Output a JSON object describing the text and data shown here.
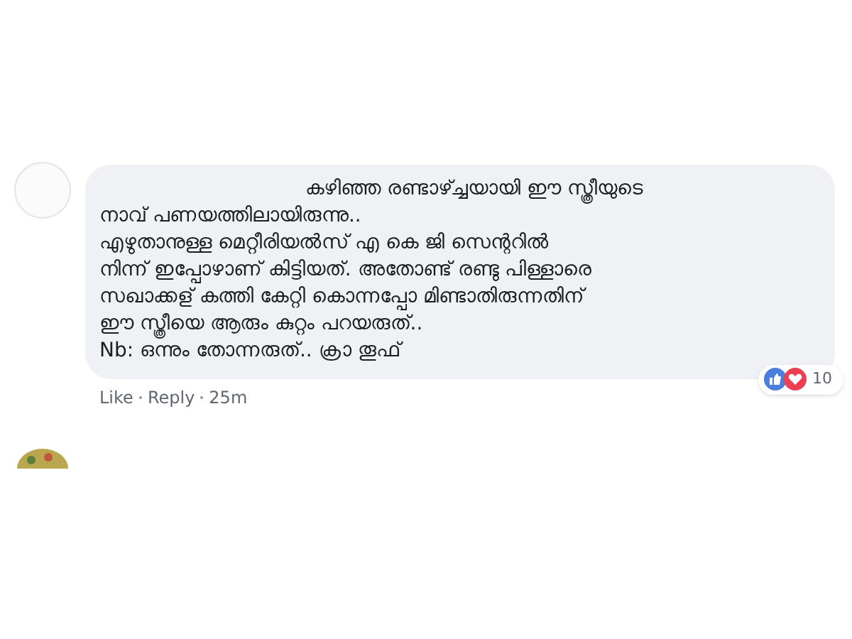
{
  "comment": {
    "lines": [
      "കഴിഞ്ഞ രണ്ടാഴ്ച്ചയായി ഈ സ്ത്രീയുടെ",
      "നാവ് പണയത്തിലായിരുന്നു..",
      "എഴുതാനുള്ള മെറ്റീരിയൽസ് എ കെ ജി സെന്ററിൽ",
      "നിന്ന് ഇപ്പോഴാണ് കിട്ടിയത്. അതോണ്ട് രണ്ടു പിള്ളാരെ",
      "സഖാക്കള് കത്തി കേറ്റി കൊന്നപ്പോ മിണ്ടാതിരുന്നതിന്",
      "ഈ സ്ത്രീയെ ആരും കുറ്റം പറയരുത്..",
      "Nb: ഒന്നും തോന്നരുത്.. ക്രാ തൂഫ്"
    ],
    "reaction_count": "10",
    "actions": [
      "Like",
      "Reply"
    ],
    "time": "25m"
  }
}
